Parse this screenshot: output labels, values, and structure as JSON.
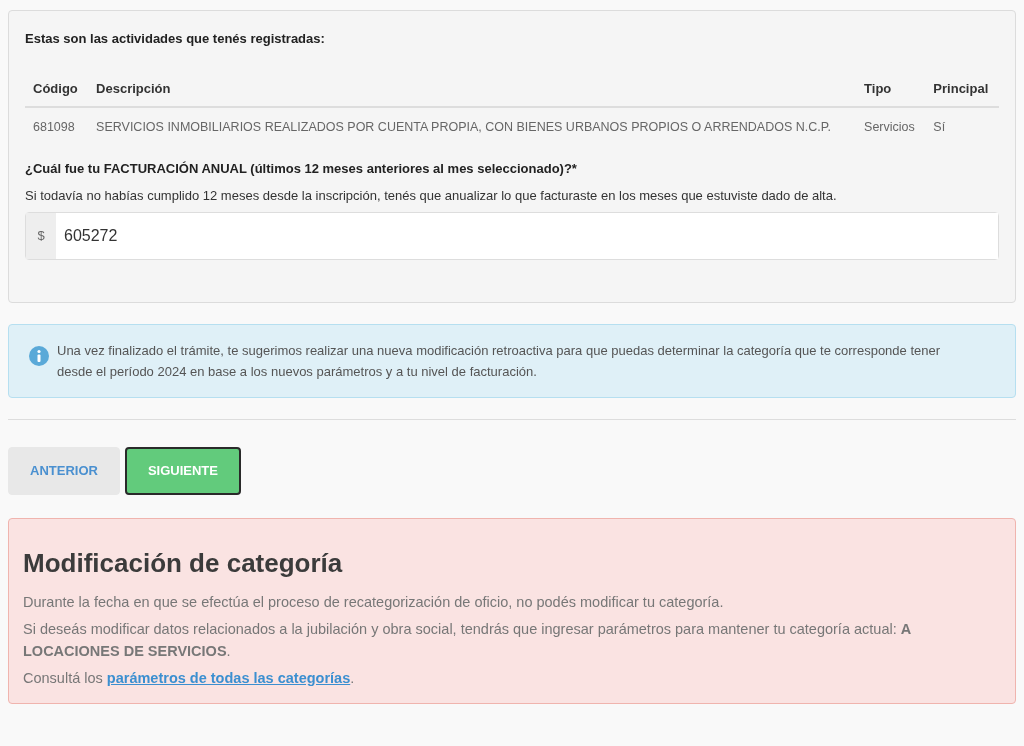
{
  "activities": {
    "intro": "Estas son las actividades que tenés registradas:",
    "columns": [
      "Código",
      "Descripción",
      "Tipo",
      "Principal"
    ],
    "rows": [
      {
        "code": "681098",
        "description": "SERVICIOS INMOBILIARIOS REALIZADOS POR CUENTA PROPIA, CON BIENES URBANOS PROPIOS O ARRENDADOS N.C.P.",
        "type": "Servicios",
        "principal": "Sí"
      }
    ]
  },
  "billing": {
    "question": "¿Cuál fue tu FACTURACIÓN ANUAL (últimos 12 meses anteriores al mes seleccionado)?*",
    "hint": "Si todavía no habías cumplido 12 meses desde la inscripción, tenés que anualizar lo que facturaste en los meses que estuviste dado de alta.",
    "prefix": "$",
    "value": "605272"
  },
  "info": "Una vez finalizado el trámite, te sugerimos realizar una nueva modificación retroactiva para que puedas determinar la categoría que te corresponde tener desde el período 2024 en base a los nuevos parámetros y a tu nivel de facturación.",
  "buttons": [
    {
      "label": "ANTERIOR",
      "kind": "secondary"
    },
    {
      "label": "SIGUIENTE",
      "kind": "primary"
    }
  ],
  "alert": {
    "title": "Modificación de categoría",
    "paragraphs": [
      "Durante la fecha en que se efectúa el proceso de recategorización de oficio, no podés modificar tu categoría.",
      "Si deseás modificar datos relacionados a la jubilación y obra social, tendrás que ingresar parámetros para mantener tu categoría actual: **A LOCACIONES DE SERVICIOS**."
    ],
    "consult": {
      "before": "Consultá los",
      "link": "parámetros de todas las categorías",
      "after": "."
    }
  }
}
